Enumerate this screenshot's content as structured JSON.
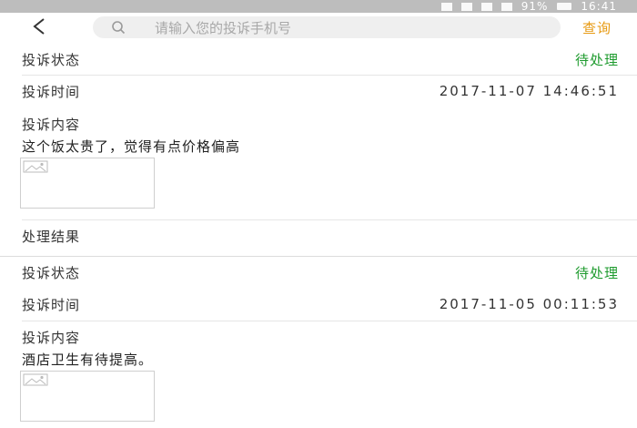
{
  "status_bar": {
    "battery": "91%",
    "time": "16:41"
  },
  "header": {
    "search_placeholder": "请输入您的投诉手机号",
    "query_label": "查询"
  },
  "records": [
    {
      "status_label": "投诉状态",
      "status_value": "待处理",
      "time_label": "投诉时间",
      "time_value": "2017-11-07 14:46:51",
      "content_label": "投诉内容",
      "content_text": "这个饭太贵了，觉得有点价格偏高",
      "result_label": "处理结果"
    },
    {
      "status_label": "投诉状态",
      "status_value": "待处理",
      "time_label": "投诉时间",
      "time_value": "2017-11-05 00:11:53",
      "content_label": "投诉内容",
      "content_text": "酒店卫生有待提高。"
    }
  ],
  "colors": {
    "accent_query": "#e79a12",
    "status_pending": "#1e9b2e",
    "status_bar_bg": "#bdbdbd"
  },
  "icons": {
    "back": "back-arrow-icon",
    "search": "search-icon",
    "image_placeholder": "image-placeholder-icon"
  }
}
